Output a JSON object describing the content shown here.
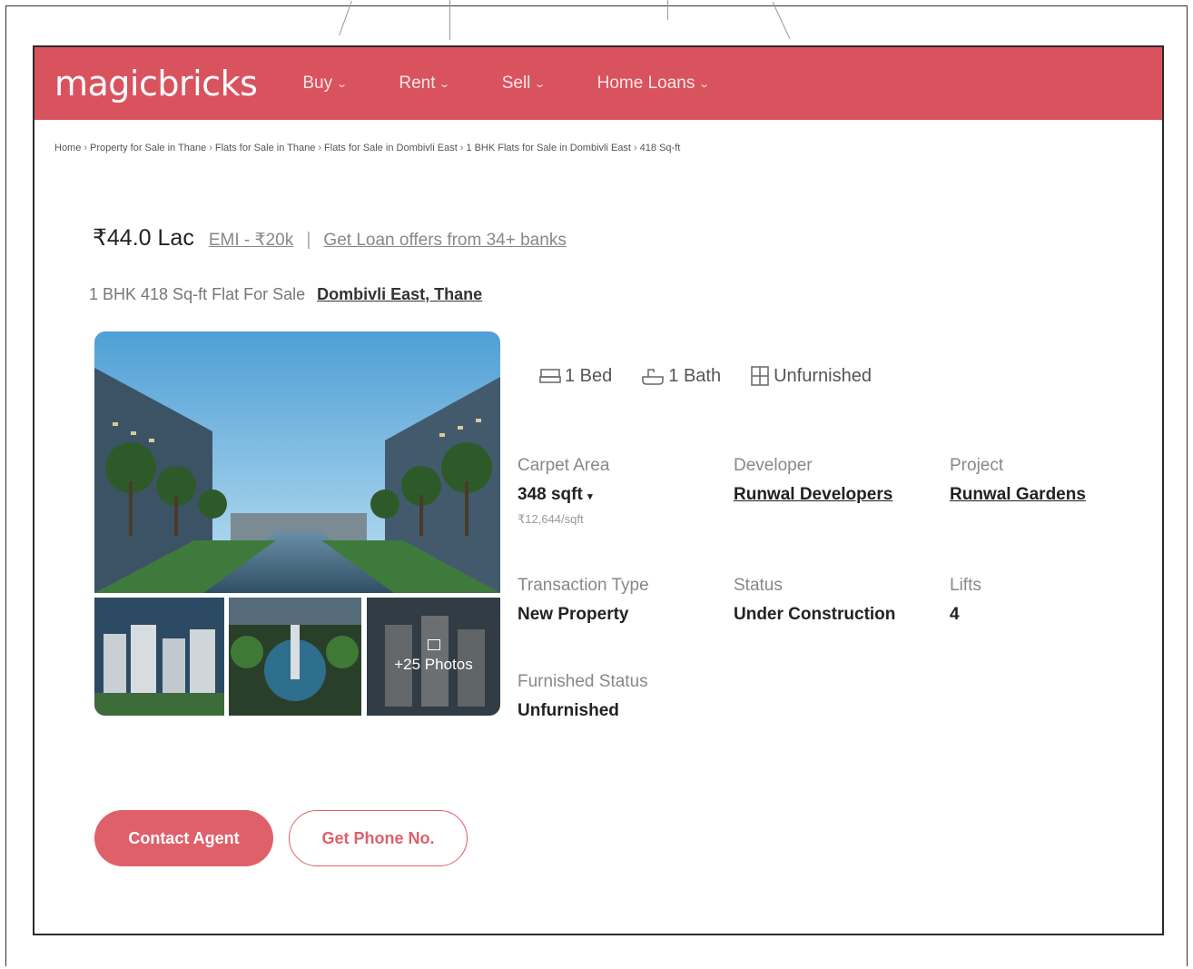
{
  "header": {
    "logo": "magicbricks",
    "nav": [
      {
        "label": "Buy"
      },
      {
        "label": "Rent"
      },
      {
        "label": "Sell"
      },
      {
        "label": "Home Loans"
      }
    ]
  },
  "breadcrumb": [
    "Home",
    "Property for Sale in Thane",
    "Flats for Sale in Thane",
    "Flats for Sale in Dombivli East",
    "1 BHK Flats for Sale in Dombivli East",
    "418 Sq-ft"
  ],
  "listing": {
    "price": "₹44.0 Lac",
    "emi": "EMI - ₹20k",
    "separator": "|",
    "loan_offer": "Get Loan offers from 34+ banks",
    "title": "1 BHK 418 Sq-ft Flat For Sale",
    "location": "Dombivli East, Thane"
  },
  "gallery": {
    "more_photos": "+25 Photos"
  },
  "amenities": [
    {
      "icon": "bed-icon",
      "label": "1 Bed"
    },
    {
      "icon": "bath-icon",
      "label": "1 Bath"
    },
    {
      "icon": "furnishing-icon",
      "label": "Unfurnished"
    }
  ],
  "details": {
    "carpet_area": {
      "label": "Carpet Area",
      "value": "348 sqft",
      "sub": "₹12,644/sqft"
    },
    "developer": {
      "label": "Developer",
      "value": "Runwal Developers"
    },
    "project": {
      "label": "Project",
      "value": "Runwal Gardens"
    },
    "transaction_type": {
      "label": "Transaction Type",
      "value": "New Property"
    },
    "status": {
      "label": "Status",
      "value": "Under Construction"
    },
    "lifts": {
      "label": "Lifts",
      "value": "4"
    },
    "furnished_status": {
      "label": "Furnished Status",
      "value": "Unfurnished"
    }
  },
  "actions": {
    "contact_agent": "Contact Agent",
    "get_phone": "Get Phone No."
  },
  "colors": {
    "brand": "#d9535f",
    "button": "#e0606a"
  }
}
